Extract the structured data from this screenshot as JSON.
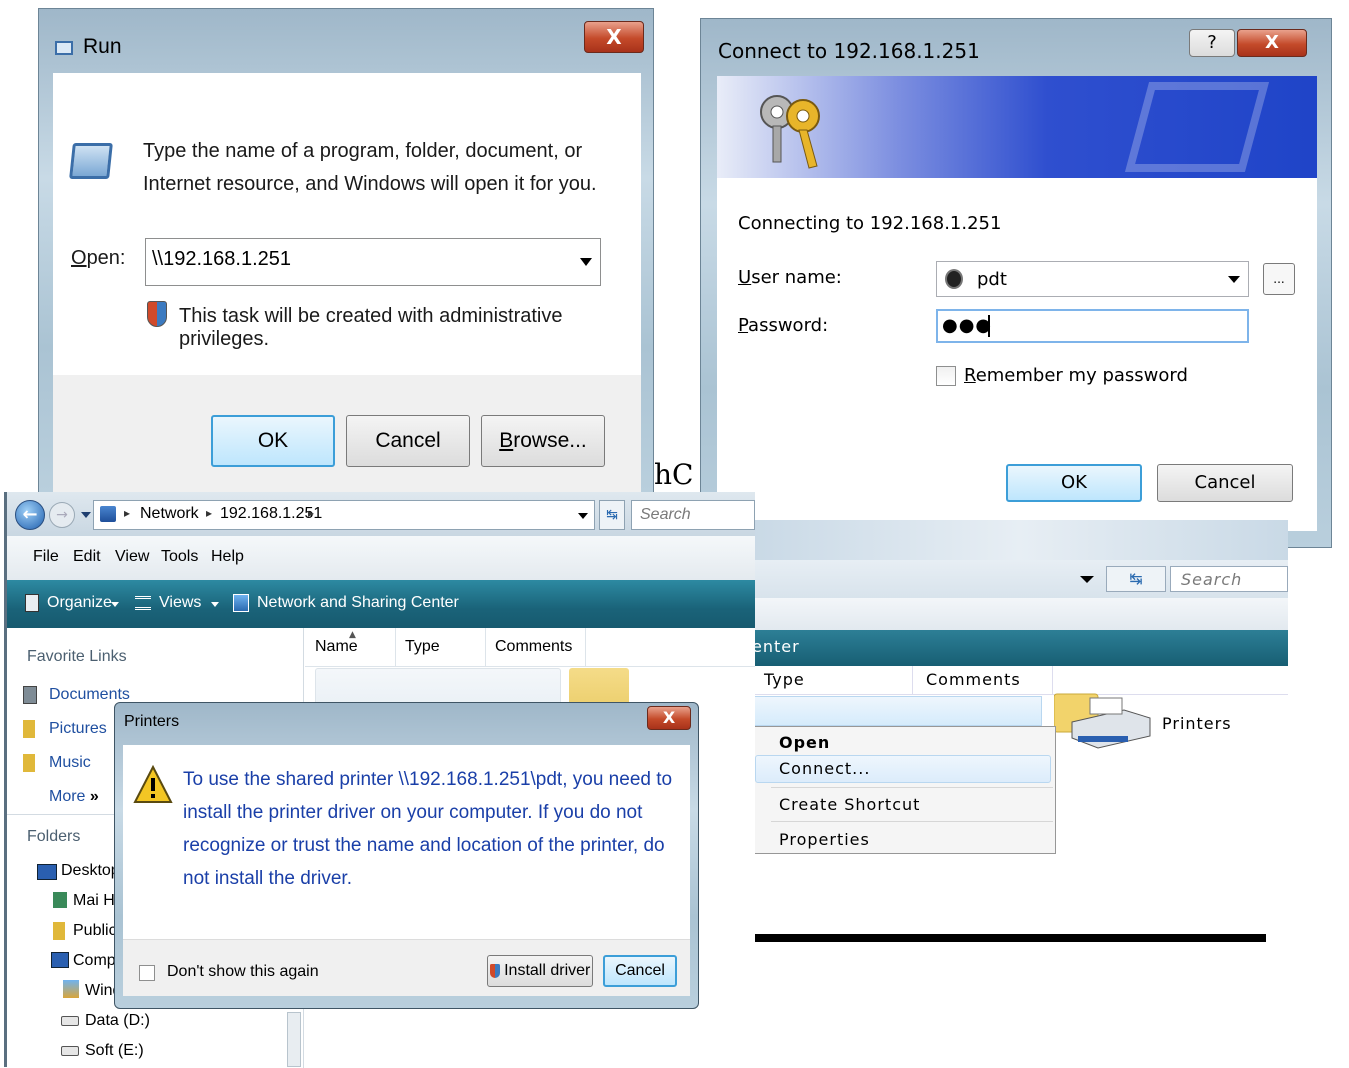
{
  "run_dialog": {
    "title": "Run",
    "description": "Type the name of a program, folder, document, or Internet resource, and Windows will open it for you.",
    "open_label": "Open:",
    "open_value": "\\\\192.168.1.251",
    "admin_note": "This task will be created with administrative privileges.",
    "ok": "OK",
    "cancel": "Cancel",
    "browse": "Browse...",
    "close": "X"
  },
  "connect_dialog": {
    "title": "Connect to 192.168.1.251",
    "connecting_text": "Connecting to 192.168.1.251",
    "username_label": "User name:",
    "username_value": "pdt",
    "password_label": "Password:",
    "password_value": "●●●",
    "remember_label": "Remember my password",
    "ok": "OK",
    "cancel": "Cancel",
    "help": "?",
    "close": "X",
    "browse_small": "..."
  },
  "stray_text": "hC",
  "explorer": {
    "breadcrumb": [
      "Network",
      "192.168.1.251"
    ],
    "search_placeholder": "Search",
    "menu": [
      "File",
      "Edit",
      "View",
      "Tools",
      "Help"
    ],
    "toolbar": {
      "organize": "Organize",
      "views": "Views",
      "network_center": "Network and Sharing Center"
    },
    "columns": [
      "Name",
      "Type",
      "Comments"
    ],
    "favorite_links_header": "Favorite Links",
    "favorite_links": [
      "Documents",
      "Pictures",
      "Music"
    ],
    "more": "More",
    "more_glyph": "»",
    "folders_header": "Folders",
    "tree": [
      "Desktop",
      "Mai Hu",
      "Public",
      "Compu",
      "Wind",
      "Data (D:)",
      "Soft (E:)"
    ]
  },
  "printers_dialog": {
    "title": "Printers",
    "message": "To use the shared printer \\\\192.168.1.251\\pdt, you need to install the printer driver on your computer.  If you do not recognize or trust the name and location of the printer, do not install the driver.",
    "dont_show": "Don't show this again",
    "install": "Install driver",
    "cancel": "Cancel",
    "close": "X"
  },
  "explorer2": {
    "search_placeholder": "Search",
    "toolbar_fragment": "enter",
    "columns": [
      "Type",
      "Comments"
    ],
    "item": "Printers",
    "context_menu": [
      "Open",
      "Connect...",
      "Create Shortcut",
      "Properties"
    ]
  },
  "colors": {
    "glass_frame": "#b4cad9",
    "toolbar_teal": "#1e6f86",
    "link_blue": "#1f4fa0",
    "message_blue": "#1a3fa8",
    "close_red": "#c44a2a",
    "default_button_border": "#3c9ed8"
  }
}
